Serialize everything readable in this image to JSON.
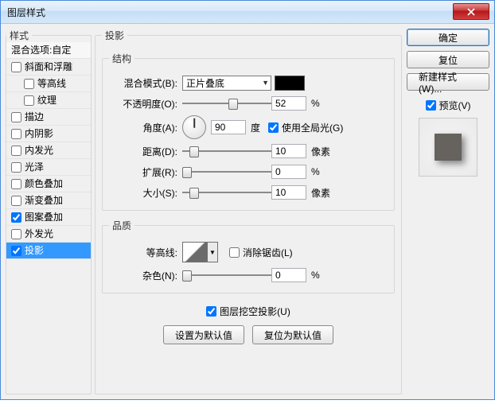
{
  "window": {
    "title": "图层样式"
  },
  "styles_panel": {
    "header": "样式",
    "blend_header": "混合选项:自定",
    "items": [
      {
        "label": "斜面和浮雕",
        "checked": false
      },
      {
        "label": "等高线",
        "checked": false,
        "sub": true
      },
      {
        "label": "纹理",
        "checked": false,
        "sub": true
      },
      {
        "label": "描边",
        "checked": false
      },
      {
        "label": "内阴影",
        "checked": false
      },
      {
        "label": "内发光",
        "checked": false
      },
      {
        "label": "光泽",
        "checked": false
      },
      {
        "label": "颜色叠加",
        "checked": false
      },
      {
        "label": "渐变叠加",
        "checked": false
      },
      {
        "label": "图案叠加",
        "checked": true
      },
      {
        "label": "外发光",
        "checked": false
      },
      {
        "label": "投影",
        "checked": true,
        "selected": true
      }
    ]
  },
  "shadow": {
    "title": "投影",
    "structure": {
      "legend": "结构",
      "blend_mode": {
        "label": "混合模式(B):",
        "value": "正片叠底",
        "swatch": "#000000"
      },
      "opacity": {
        "label": "不透明度(O):",
        "value": "52",
        "unit": "%",
        "pct": 52
      },
      "angle": {
        "label": "角度(A):",
        "value": "90",
        "unit": "度",
        "deg": -90
      },
      "global": {
        "label": "使用全局光(G)",
        "checked": true
      },
      "distance": {
        "label": "距离(D):",
        "value": "10",
        "unit": "像素",
        "pct": 8
      },
      "spread": {
        "label": "扩展(R):",
        "value": "0",
        "unit": "%",
        "pct": 0
      },
      "size": {
        "label": "大小(S):",
        "value": "10",
        "unit": "像素",
        "pct": 8
      }
    },
    "quality": {
      "legend": "品质",
      "contour": {
        "label": "等高线:"
      },
      "antialias": {
        "label": "消除锯齿(L)",
        "checked": false
      },
      "noise": {
        "label": "杂色(N):",
        "value": "0",
        "unit": "%",
        "pct": 0
      }
    },
    "knockout": {
      "label": "图层挖空投影(U)",
      "checked": true
    },
    "buttons": {
      "make_default": "设置为默认值",
      "reset_default": "复位为默认值"
    }
  },
  "right": {
    "ok": "确定",
    "reset": "复位",
    "new_style": "新建样式(W)...",
    "preview": {
      "label": "预览(V)",
      "checked": true
    }
  }
}
